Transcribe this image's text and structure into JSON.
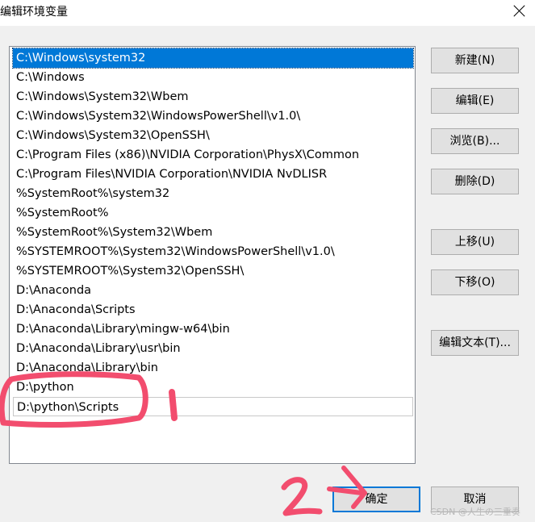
{
  "window": {
    "title": "编辑环境变量",
    "close_icon": "close-icon"
  },
  "list": {
    "items": [
      "C:\\Windows\\system32",
      "C:\\Windows",
      "C:\\Windows\\System32\\Wbem",
      "C:\\Windows\\System32\\WindowsPowerShell\\v1.0\\",
      "C:\\Windows\\System32\\OpenSSH\\",
      "C:\\Program Files (x86)\\NVIDIA Corporation\\PhysX\\Common",
      "C:\\Program Files\\NVIDIA Corporation\\NVIDIA NvDLISR",
      "%SystemRoot%\\system32",
      "%SystemRoot%",
      "%SystemRoot%\\System32\\Wbem",
      "%SYSTEMROOT%\\System32\\WindowsPowerShell\\v1.0\\",
      "%SYSTEMROOT%\\System32\\OpenSSH\\",
      "D:\\Anaconda",
      "D:\\Anaconda\\Scripts",
      "D:\\Anaconda\\Library\\mingw-w64\\bin",
      "D:\\Anaconda\\Library\\usr\\bin",
      "D:\\Anaconda\\Library\\bin",
      "D:\\python",
      "D:\\python\\Scripts"
    ],
    "selected_index": 0
  },
  "buttons": {
    "new": "新建(N)",
    "edit": "编辑(E)",
    "browse": "浏览(B)...",
    "delete": "删除(D)",
    "move_up": "上移(U)",
    "move_down": "下移(O)",
    "edit_text": "编辑文本(T)...",
    "ok": "确定",
    "cancel": "取消"
  },
  "annotations": {
    "step1": "1",
    "step2": "2",
    "ink_color": "#f24d6e"
  },
  "watermark": "CSDN @人生の三重奏",
  "colors": {
    "selection": "#0078d7",
    "button_face": "#e1e1e1"
  }
}
